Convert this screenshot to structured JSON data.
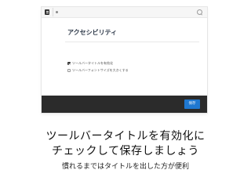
{
  "screenshot": {
    "panel_title": "アクセシビリティ",
    "options": [
      {
        "label": "ツールバータイトルを有効化",
        "checked": true
      },
      {
        "label": "ツールバーフォントサイズを大きくする",
        "checked": false
      }
    ],
    "save_label": "保存",
    "icons": {
      "app": "app-icon",
      "search": "search-icon"
    }
  },
  "caption": {
    "line1": "ツールバータイトルを有効化に",
    "line2": "チェックして保存しましょう",
    "sub": "慣れるまではタイトルを出した方が便利"
  }
}
